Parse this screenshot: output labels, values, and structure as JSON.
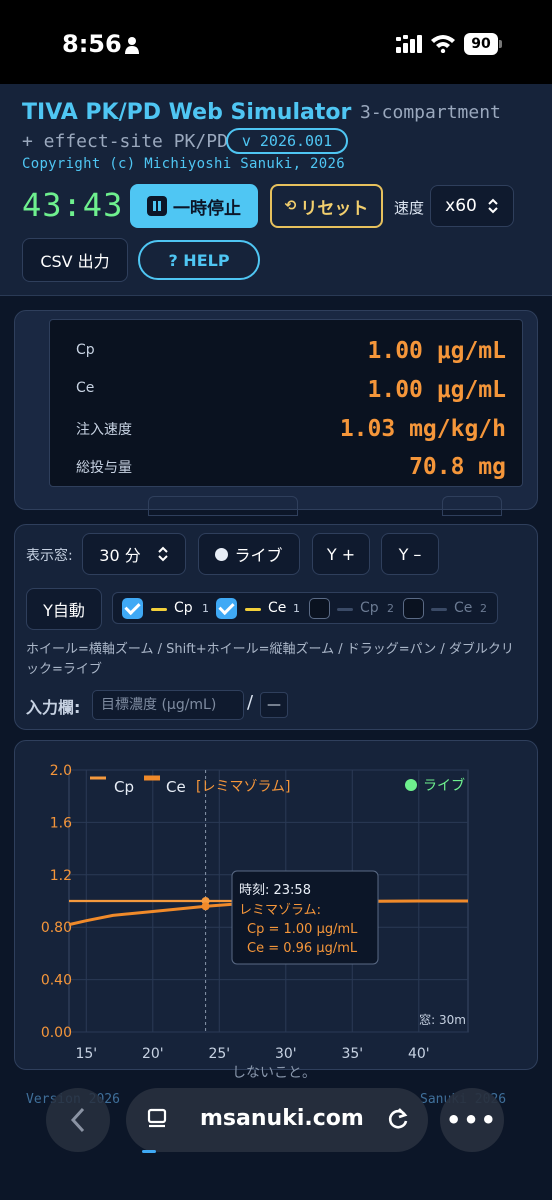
{
  "status_bar": {
    "time": "8:56",
    "battery": "90"
  },
  "header": {
    "title": "TIVA PK/PD Web Simulator",
    "subtitle_1": "3-compartment",
    "subtitle_2": "+ effect-site PK/PD",
    "version": "v 2026.001",
    "copyright": "Copyright (c) Michiyoshi Sanuki, 2026"
  },
  "controls": {
    "timer": "43:43",
    "pause_label": "一時停止",
    "reset_label": "リセット",
    "speed_label": "速度",
    "speed_value": "x60",
    "csv_label": "CSV 出力",
    "help_label": "? HELP"
  },
  "readout": {
    "rows": [
      {
        "label": "Cp",
        "value": "1.00 μg/mL"
      },
      {
        "label": "Ce",
        "value": "1.00 μg/mL"
      },
      {
        "label": "注入速度",
        "value": "1.03 mg/kg/h"
      },
      {
        "label": "総投与量",
        "value": "70.8 mg"
      }
    ]
  },
  "chart_controls": {
    "window_label": "表示窓:",
    "window_value": "30 分",
    "live_label": "ライブ",
    "y_plus": "Y +",
    "y_minus": "Y –",
    "y_auto": "Y自動",
    "legend": [
      {
        "label": "Cp",
        "index": "1",
        "checked": true,
        "color": "#f2cf3a"
      },
      {
        "label": "Ce",
        "index": "1",
        "checked": true,
        "color": "#f2cf3a"
      },
      {
        "label": "Cp",
        "index": "2",
        "checked": false,
        "color": "#3a4a66"
      },
      {
        "label": "Ce",
        "index": "2",
        "checked": false,
        "color": "#3a4a66"
      }
    ],
    "hint": "ホイール=横軸ズーム / Shift+ホイール=縦軸ズーム / ドラッグ=パン / ダブルクリック=ライブ",
    "input_label": "入力欄:",
    "input_placeholder": "目標濃度 (μg/mL)",
    "slash": "/",
    "unit_box": "—"
  },
  "chart_data": {
    "type": "line",
    "legend": [
      "Cp",
      "Ce",
      "[レミマゾラム]"
    ],
    "live_label": "ライブ",
    "window_note": "窓: 30m",
    "x_ticks": [
      "15'",
      "20'",
      "25'",
      "30'",
      "35'",
      "40'"
    ],
    "x_tick_values": [
      15,
      20,
      25,
      30,
      35,
      40
    ],
    "y_ticks": [
      "2.0",
      "1.6",
      "1.2",
      "0.80",
      "0.40",
      "0.00"
    ],
    "y_tick_values": [
      2.0,
      1.6,
      1.2,
      0.8,
      0.4,
      0.0
    ],
    "xlim": [
      13.7,
      43.7
    ],
    "ylim": [
      0,
      2.0
    ],
    "grid": true,
    "target_line": 1.0,
    "cursor_x": 23.97,
    "series": [
      {
        "name": "Cp",
        "color": "#f59a3e",
        "x": [
          13.7,
          15,
          20,
          24,
          30,
          35,
          40,
          43.7
        ],
        "y": [
          1.0,
          1.0,
          1.0,
          1.0,
          1.0,
          1.0,
          1.0,
          1.0
        ]
      },
      {
        "name": "Ce",
        "color": "#f08a2a",
        "x": [
          13.7,
          15,
          17,
          20,
          22,
          24,
          26,
          28,
          30,
          35,
          40,
          43.7
        ],
        "y": [
          0.82,
          0.85,
          0.89,
          0.92,
          0.94,
          0.96,
          0.975,
          0.985,
          0.99,
          0.997,
          1.0,
          1.0
        ]
      }
    ],
    "tooltip": {
      "time": "時刻: 23:58",
      "drug": "レミマゾラム:",
      "cp": "Cp = 1.00 μg/mL",
      "ce": "Ce = 0.96 μg/mL"
    }
  },
  "footer": {
    "left": "Version 2026",
    "right": "Sanuki 2026",
    "partial": "しないこと。",
    "url": "msanuki.com"
  },
  "colors": {
    "accent": "#4fc6f3",
    "orange": "#f5963a",
    "green": "#6ef08e",
    "gold": "#e7c15d"
  }
}
